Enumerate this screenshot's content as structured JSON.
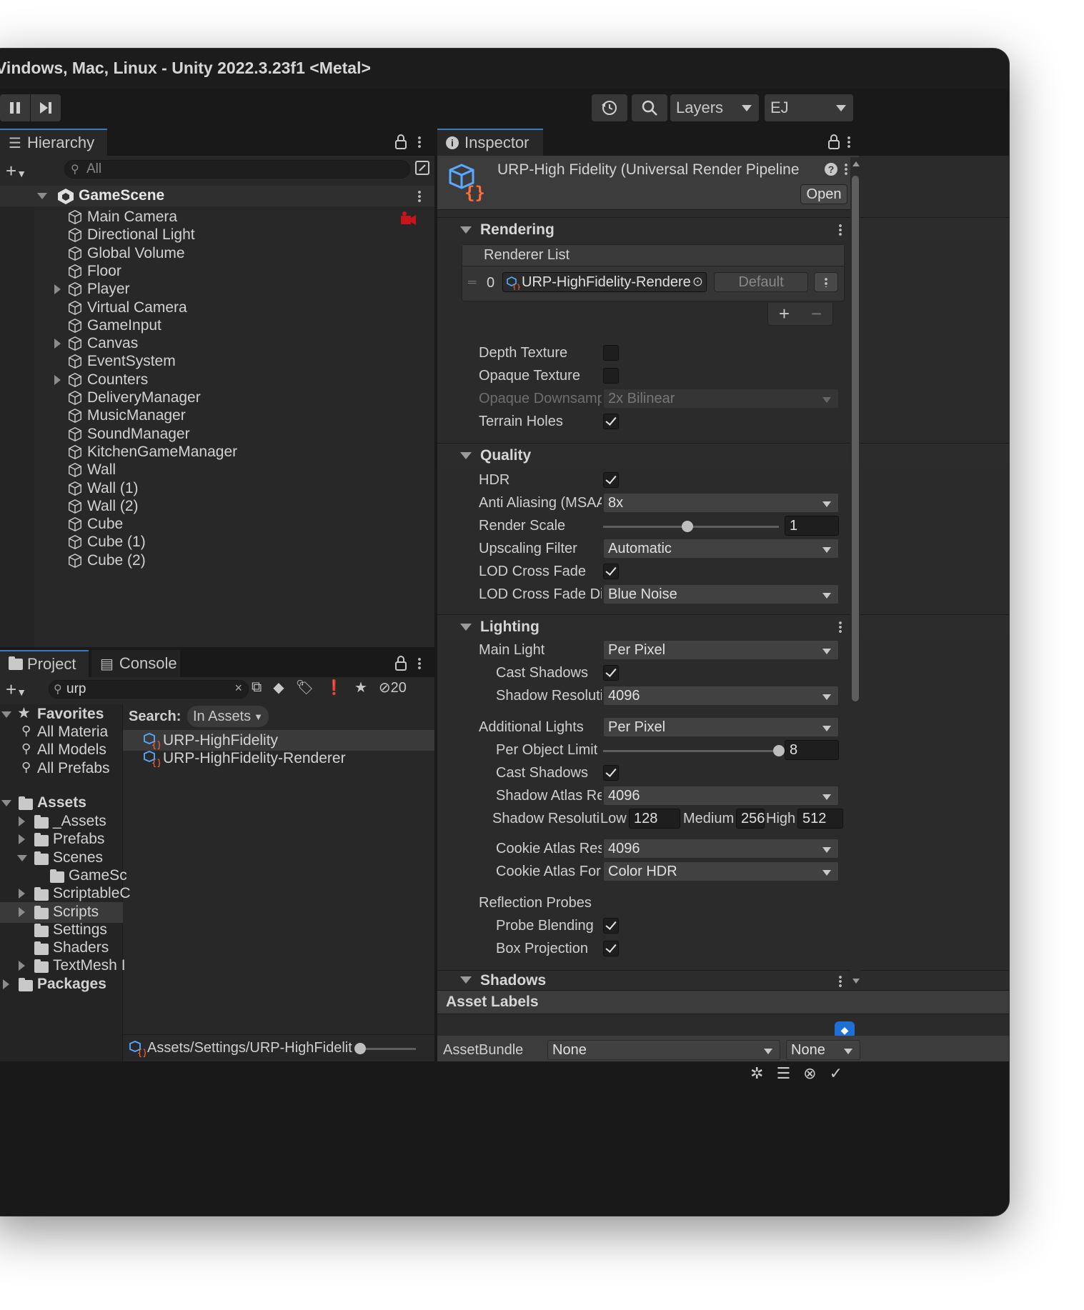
{
  "window": {
    "title": "Vindows, Mac, Linux - Unity 2022.3.23f1 <Metal>"
  },
  "toolbar": {
    "layers_label": "Layers",
    "layout_label": "EJ"
  },
  "hierarchy": {
    "tab_label": "Hierarchy",
    "search_placeholder": "All",
    "scene_name": "GameScene",
    "items": [
      {
        "label": "Main Camera"
      },
      {
        "label": "Directional Light"
      },
      {
        "label": "Global Volume"
      },
      {
        "label": "Floor"
      },
      {
        "label": "Player"
      },
      {
        "label": "Virtual Camera"
      },
      {
        "label": "GameInput"
      },
      {
        "label": "Canvas"
      },
      {
        "label": "EventSystem"
      },
      {
        "label": "Counters"
      },
      {
        "label": "DeliveryManager"
      },
      {
        "label": "MusicManager"
      },
      {
        "label": "SoundManager"
      },
      {
        "label": "KitchenGameManager"
      },
      {
        "label": "Wall"
      },
      {
        "label": "Wall (1)"
      },
      {
        "label": "Wall (2)"
      },
      {
        "label": "Cube"
      },
      {
        "label": "Cube (1)"
      },
      {
        "label": "Cube (2)"
      }
    ]
  },
  "project": {
    "tab_project": "Project",
    "tab_console": "Console",
    "search_value": "urp",
    "hidden_count": "20",
    "favorites_label": "Favorites",
    "favorites": [
      "All Materia",
      "All Models",
      "All Prefabs"
    ],
    "assets_label": "Assets",
    "assets": [
      "_Assets",
      "Prefabs",
      "Scenes",
      "GameSc",
      "ScriptableC",
      "Scripts",
      "Settings",
      "Shaders",
      "TextMesh I"
    ],
    "packages_label": "Packages",
    "search_label": "Search:",
    "search_scope": "In Assets",
    "results": [
      "URP-HighFidelity",
      "URP-HighFidelity-Renderer"
    ],
    "status_path": "Assets/Settings/URP-HighFidelit"
  },
  "inspector": {
    "tab_label": "Inspector",
    "asset_title": "URP-High Fidelity (Universal Render Pipeline",
    "open_button": "Open",
    "rendering": {
      "header": "Rendering",
      "renderer_list_label": "Renderer List",
      "renderer_index": "0",
      "renderer_name": "URP-HighFidelity-Renderer",
      "default_button": "Default",
      "depth_texture": "Depth Texture",
      "opaque_texture": "Opaque Texture",
      "opaque_downsampling": "Opaque Downsamp",
      "opaque_downsampling_value": "2x Bilinear",
      "terrain_holes": "Terrain Holes"
    },
    "quality": {
      "header": "Quality",
      "hdr": "HDR",
      "anti_aliasing": "Anti Aliasing (MSAA",
      "anti_aliasing_value": "8x",
      "render_scale": "Render Scale",
      "render_scale_value": "1",
      "render_scale_fraction": 0.48,
      "upscaling_filter": "Upscaling Filter",
      "upscaling_filter_value": "Automatic",
      "lod_cross_fade": "LOD Cross Fade",
      "lod_cross_fade_dither": "LOD Cross Fade Dit",
      "lod_cross_fade_dither_value": "Blue Noise"
    },
    "lighting": {
      "header": "Lighting",
      "main_light": "Main Light",
      "main_light_value": "Per Pixel",
      "cast_shadows": "Cast Shadows",
      "shadow_resolution": "Shadow Resoluti",
      "shadow_resolution_value": "4096",
      "additional_lights": "Additional Lights",
      "additional_lights_value": "Per Pixel",
      "per_object_limit": "Per Object Limit",
      "per_object_limit_value": "8",
      "per_object_limit_fraction": 1.0,
      "add_cast_shadows": "Cast Shadows",
      "shadow_atlas": "Shadow Atlas Re",
      "shadow_atlas_value": "4096",
      "shadow_tiers_label": "Shadow Resoluti",
      "tier_low_label": "Low",
      "tier_low_value": "128",
      "tier_medium_label": "Medium",
      "tier_medium_value": "256",
      "tier_high_label": "High",
      "tier_high_value": "512",
      "cookie_atlas_res": "Cookie Atlas Res",
      "cookie_atlas_res_value": "4096",
      "cookie_atlas_format": "Cookie Atlas For",
      "cookie_atlas_format_value": "Color HDR",
      "reflection_probes": "Reflection Probes",
      "probe_blending": "Probe Blending",
      "box_projection": "Box Projection"
    },
    "shadows_header": "Shadows",
    "asset_labels": "Asset Labels",
    "assetbundle_label": "AssetBundle",
    "assetbundle_value": "None",
    "assetbundle_variant": "None"
  }
}
